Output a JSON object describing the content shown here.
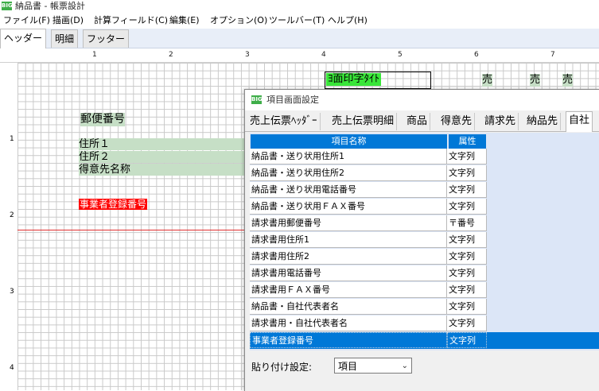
{
  "window": {
    "title": "納品書 - 帳票設計",
    "icon": "big-app-icon",
    "icon_text": "BIG"
  },
  "menu": [
    "ファイル(F)",
    "描画(D)",
    "計算フィールド(C)",
    "編集(E)",
    "オプション(O)",
    "ツールバー(T)",
    "ヘルプ(H)"
  ],
  "tabs": [
    "ヘッダー",
    "明細",
    "フッター"
  ],
  "ruler": {
    "h": [
      "1",
      "2",
      "3",
      "4",
      "5",
      "6",
      "7"
    ],
    "v": [
      "1",
      "2",
      "3",
      "4"
    ]
  },
  "canvas": {
    "postal_label": "郵便番号",
    "address1": "住所１",
    "address2": "住所２",
    "customer_name": "得意先名称",
    "registration": "事業者登録番号",
    "top_title": "ﾖ面印字ﾀｲﾄ",
    "sell_labels": [
      "売",
      "売",
      "売"
    ],
    "colors": {
      "field_bg": "#c6dfc6",
      "registration_bg": "#ff0000",
      "title_bg": "#39e639",
      "guide_line": "#e03030"
    }
  },
  "dialog": {
    "title": "項目画面設定",
    "tabs": [
      "売上伝票ﾍｯﾀﾞｰ",
      "売上伝票明細",
      "商品",
      "得意先",
      "請求先",
      "納品先",
      "自社"
    ],
    "active_tab": "自社",
    "columns": [
      "項目名称",
      "属性"
    ],
    "rows": [
      {
        "name": "納品書・送り状用住所1",
        "attr": "文字列"
      },
      {
        "name": "納品書・送り状用住所2",
        "attr": "文字列"
      },
      {
        "name": "納品書・送り状用電話番号",
        "attr": "文字列"
      },
      {
        "name": "納品書・送り状用ＦＡＸ番号",
        "attr": "文字列"
      },
      {
        "name": "請求書用郵便番号",
        "attr": "〒番号"
      },
      {
        "name": "請求書用住所1",
        "attr": "文字列"
      },
      {
        "name": "請求書用住所2",
        "attr": "文字列"
      },
      {
        "name": "請求書用電話番号",
        "attr": "文字列"
      },
      {
        "name": "請求書用ＦＡＸ番号",
        "attr": "文字列"
      },
      {
        "name": "納品書・自社代表者名",
        "attr": "文字列"
      },
      {
        "name": "請求書用・自社代表者名",
        "attr": "文字列"
      },
      {
        "name": "事業者登録番号",
        "attr": "文字列",
        "selected": true
      }
    ],
    "paste_label": "貼り付け設定:",
    "paste_value": "項目",
    "selection_color": "#0078d7"
  }
}
